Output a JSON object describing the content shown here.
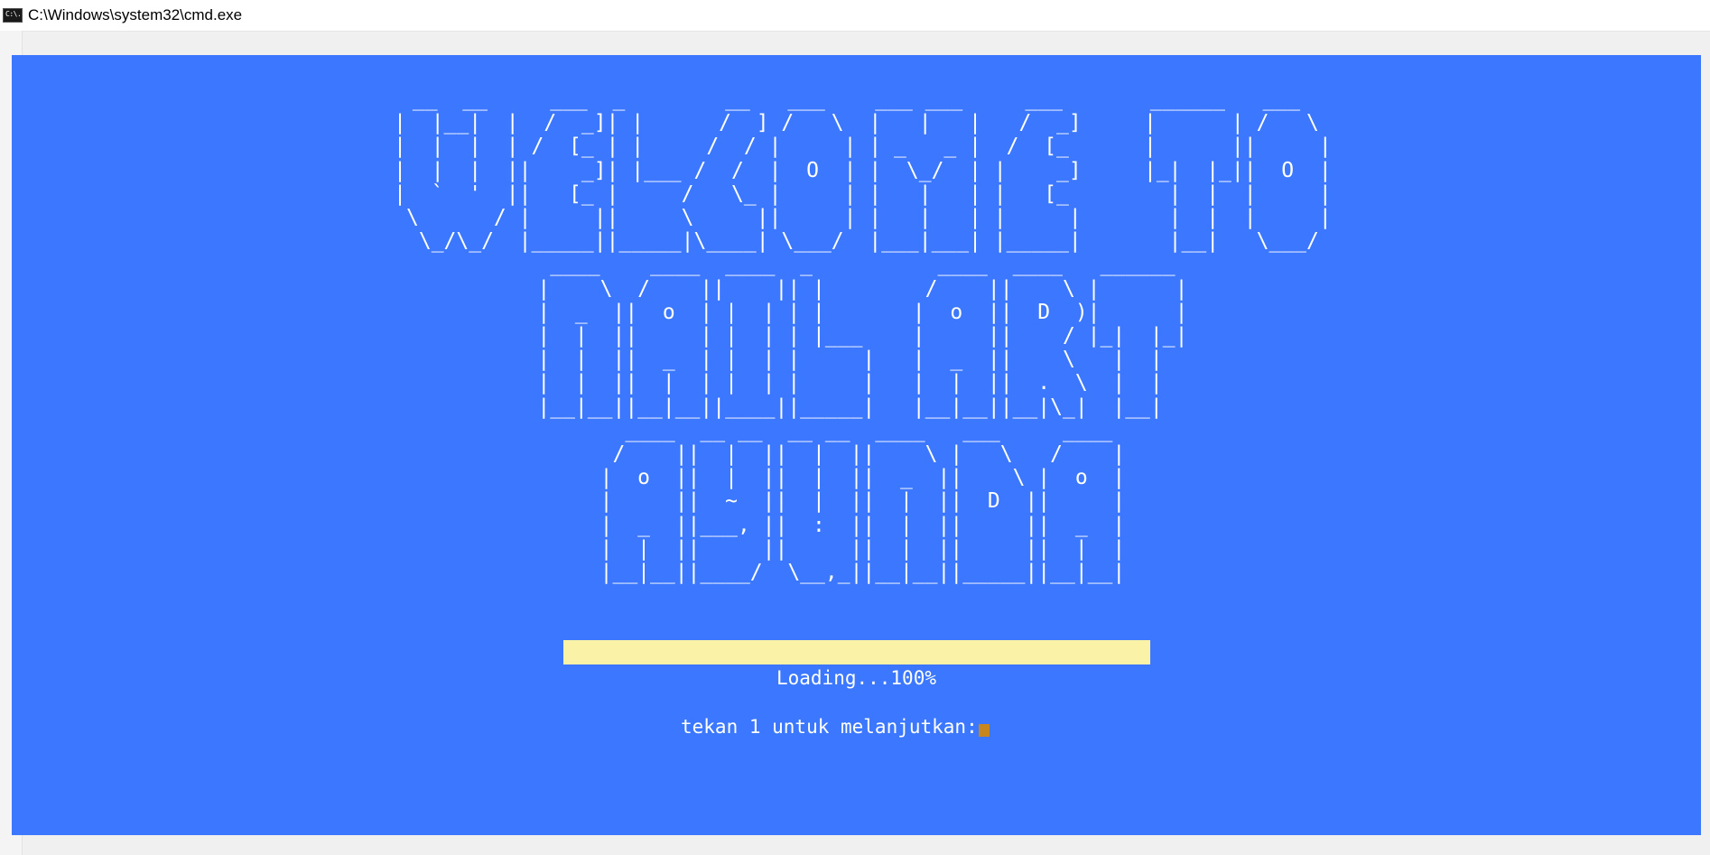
{
  "window": {
    "title": "C:\\Windows\\system32\\cmd.exe",
    "icon_label": "C:\\."
  },
  "console": {
    "background": "#3c78ff",
    "text_color": "#ffffff",
    "ascii_art": [
      "   __  __     ___  _        __   ___    ___ ___     ___       ______   ___   ",
      "  |  |__|  |  /  _]| |      /  ] /   \\  |   |   |   /  _]     |      | /   \\  ",
      "  |  |  |  | /  [_ | |     /  / |     | | _   _ |  /  [_      |      ||     | ",
      "  |  |  |  ||    _]| |___ /  /  |  O  | |  \\_/  | |    _]     |_|  |_||  O  | ",
      "  |  `  '  ||   [_ |     /   \\_ |     | |   |   | |   [_        |  |  |     | ",
      "   \\      / |     ||     \\     ||     | |   |   | |     |       |  |  |     | ",
      "    \\_/\\_/  |_____||_____|\\____| \\___/  |___|___| |_____|       |__|   \\___/  ",
      "  ____    ____  ____  _          ____  ____   ______ ",
      " |    \\  /    ||    || |        /    ||    \\ |      |",
      " |  _  ||  o  | |  | | |       |  o  ||  D  )|      |",
      " |  |  ||     | |  | | |___    |     ||    / |_|  |_|",
      " |  |  ||  _  | |  | |     |   |  _  ||    \\   |  |  ",
      " |  |  ||  |  | |  | |     |   |  |  ||  .  \\  |  |  ",
      " |__|__||__|__||____||_____|   |__|__||__|\\_|  |__|  ",
      "   ____  __ __  __ __  ____   ___     ____ ",
      "  /    ||  |  ||  |  ||    \\ |   \\   /    |",
      " |  o  ||  |  ||  |  ||  _  ||    \\ |  o  |",
      " |     ||  ~  ||  |  ||  |  ||  D  ||     |",
      " |  _  ||___, ||  :  ||  |  ||     ||  _  |",
      " |  |  ||     ||     ||  |  ||     ||  |  |",
      " |__|__||____/  \\__,_||__|__||_____||__|__|"
    ],
    "progress": {
      "value": 100,
      "bar_color": "#faf2a6",
      "label": "Loading...100%"
    },
    "prompt": {
      "text": "tekan 1 untuk melanjutkan:",
      "cursor_color": "#c8861e"
    }
  }
}
